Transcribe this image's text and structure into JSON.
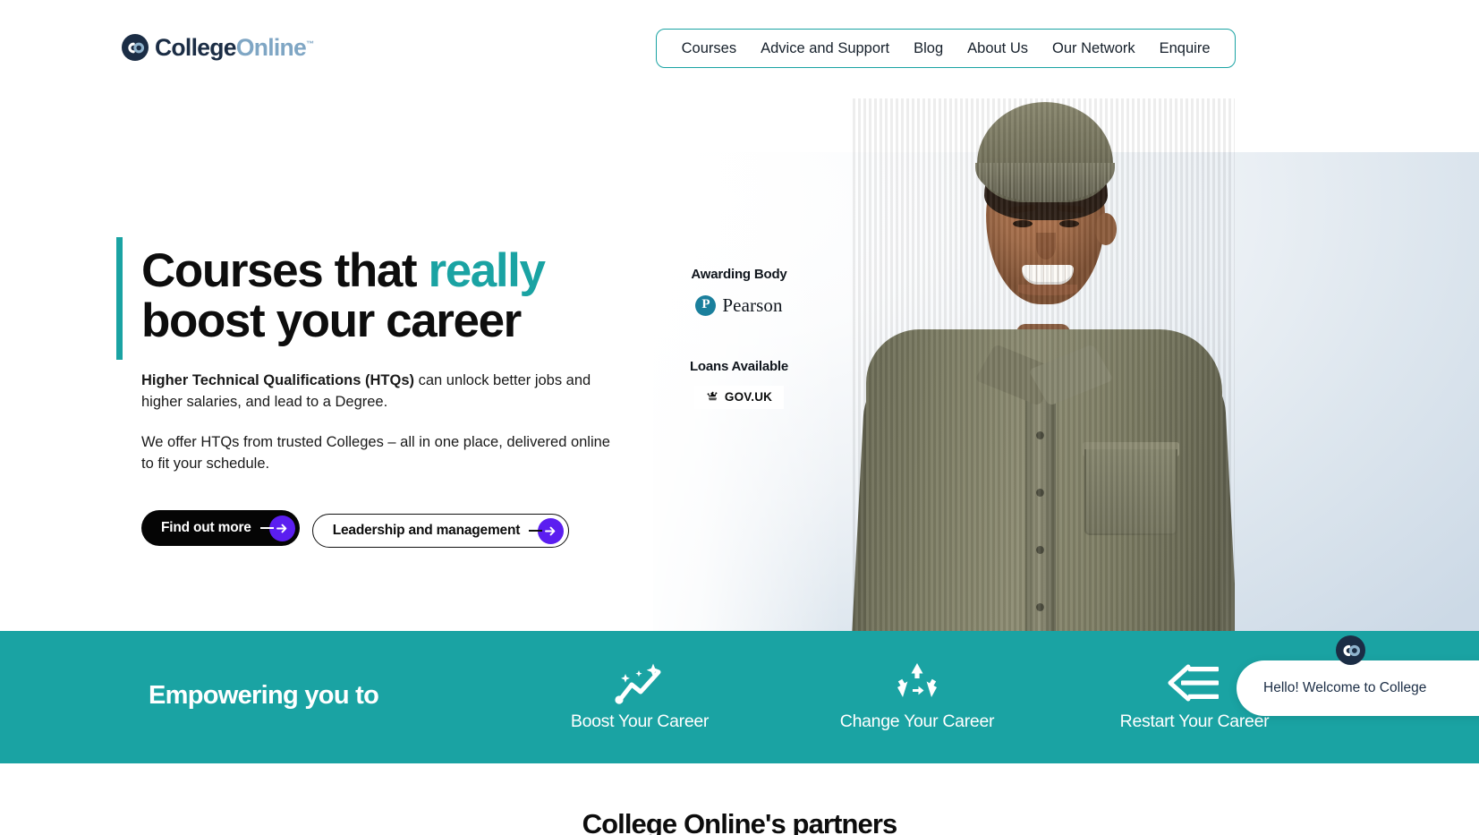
{
  "brand": {
    "logo_icon": "co-monogram-icon",
    "name_primary": "College",
    "name_secondary": "Online",
    "trademark": "™",
    "accent_teal": "#1aa3a3",
    "navy": "#1b2d45",
    "purple": "#5b1ef0"
  },
  "nav": {
    "items": [
      {
        "label": "Courses"
      },
      {
        "label": "Advice and Support"
      },
      {
        "label": "Blog"
      },
      {
        "label": "About Us"
      },
      {
        "label": "Our Network"
      },
      {
        "label": "Enquire"
      }
    ]
  },
  "hero": {
    "title_line1_plain": "Courses that ",
    "title_line1_accent": "really",
    "title_line2": "boost your career",
    "paragraph1_bold": "Higher Technical Qualifications (HTQs)",
    "paragraph1_rest": " can unlock better jobs and higher salaries, and lead to a Degree.",
    "paragraph2": "We offer HTQs from trusted Colleges – all in one place, delivered online to fit your schedule.",
    "primary_button": "Find out more",
    "secondary_button": "Leadership and management",
    "arrow_icon": "arrow-right-icon"
  },
  "badges": {
    "awarding_body_label": "Awarding Body",
    "awarding_body_name": "Pearson",
    "pearson_icon": "pearson-p-icon",
    "loans_label": "Loans Available",
    "govuk_crown_icon": "crown-icon",
    "govuk_text": "GOV.UK"
  },
  "band": {
    "title": "Empowering you to",
    "items": [
      {
        "label": "Boost Your Career",
        "icon": "chart-sparkle-icon"
      },
      {
        "label": "Change Your Career",
        "icon": "recycle-icon"
      },
      {
        "label": "Restart Your Career",
        "icon": "arrow-left-lines-icon"
      }
    ]
  },
  "chat": {
    "avatar_icon": "co-monogram-icon",
    "message": "Hello! Welcome to College"
  },
  "partners": {
    "title": "College Online's partners"
  }
}
